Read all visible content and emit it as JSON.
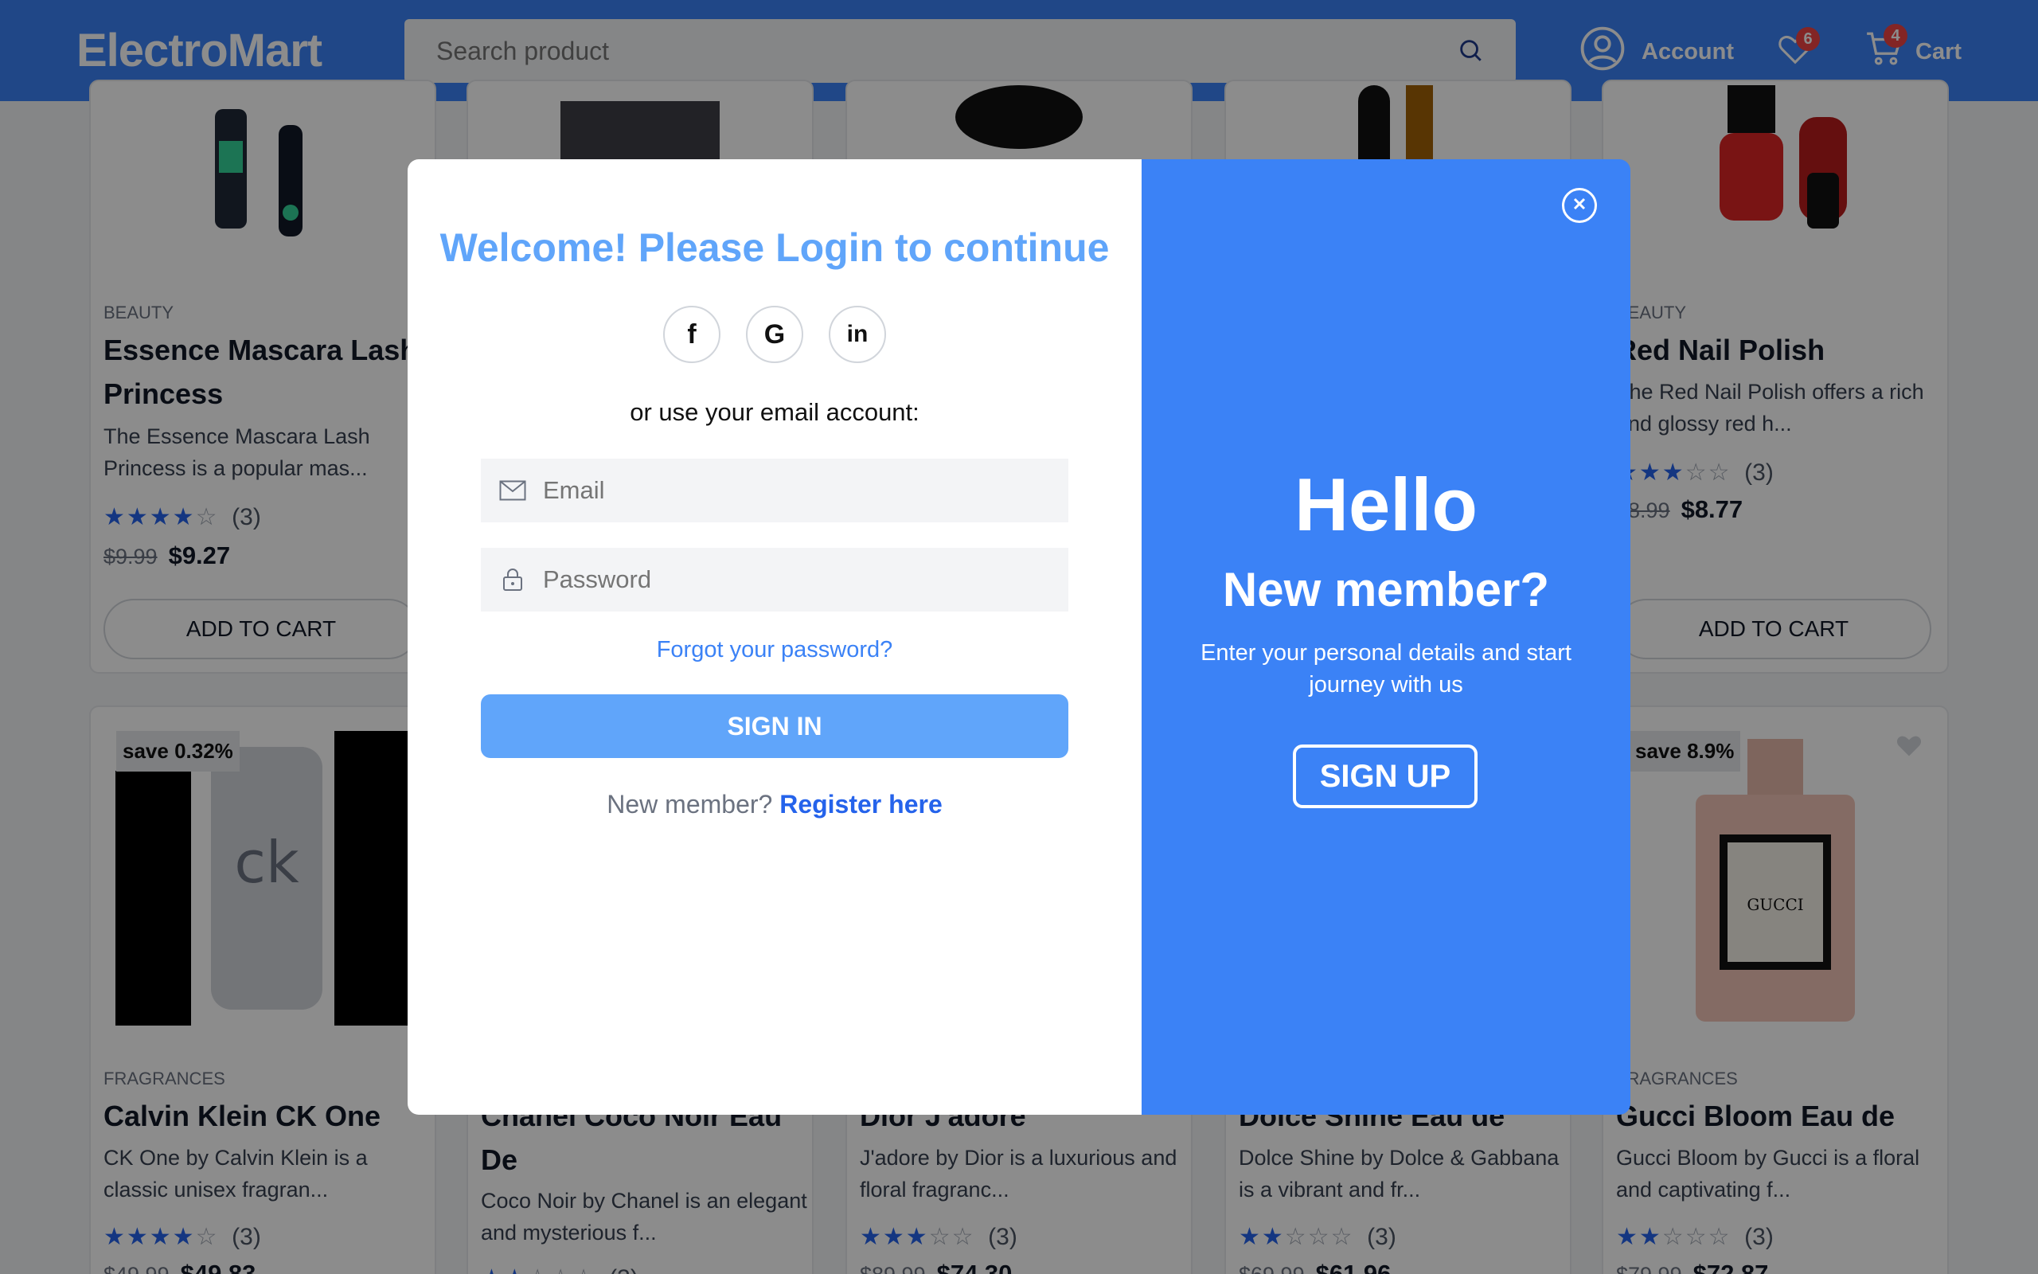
{
  "header": {
    "logo": "ElectroMart",
    "search_placeholder": "Search product",
    "account_label": "Account",
    "wishlist_count": "6",
    "cart_count": "4",
    "cart_label": "Cart"
  },
  "products_row1": [
    {
      "category": "BEAUTY",
      "name": "Essence Mascara Lash Princess",
      "description": "The Essence Mascara Lash Princess is a popular mas...",
      "rating_count": "(3)",
      "stars": 4,
      "old_price": "$9.99",
      "price": "$9.27",
      "button": "ADD TO CART"
    },
    {
      "category": "BEAUTY",
      "name": "Red Nail Polish",
      "description": "The Red Nail Polish offers a rich and glossy red h...",
      "rating_count": "(3)",
      "stars": 3,
      "old_price": "$8.99",
      "price": "$8.77",
      "button": "ADD TO CART"
    }
  ],
  "products_row2": [
    {
      "save": "save 0.32%",
      "category": "FRAGRANCES",
      "name": "Calvin Klein CK One",
      "description": "CK One by Calvin Klein is a classic unisex fragran...",
      "rating_count": "(3)",
      "stars": 4,
      "old_price": "$49.99",
      "price": "$49.83"
    },
    {
      "category": "",
      "name": "Chanel Coco Noir Eau De",
      "description": "Coco Noir by Chanel is an elegant and mysterious f...",
      "rating_count": "(3)"
    },
    {
      "category": "",
      "name": "Dior J'adore",
      "description": "J'adore by Dior is a luxurious and floral fragranc...",
      "rating_count": "(3)",
      "stars": 3,
      "old_price": "$89.99",
      "price": "$74.30"
    },
    {
      "category": "",
      "name": "Dolce Shine Eau de",
      "description": "Dolce Shine by Dolce & Gabbana is a vibrant and fr...",
      "rating_count": "(3)",
      "stars": 2,
      "old_price": "$69.99",
      "price": "$61.96"
    },
    {
      "save": "save 8.9%",
      "category": "FRAGRANCES",
      "name": "Gucci Bloom Eau de",
      "description": "Gucci Bloom by Gucci is a floral and captivating f...",
      "rating_count": "(3)",
      "stars": 2,
      "old_price": "$79.99",
      "price": "$72.87"
    }
  ],
  "login": {
    "title": "Welcome! Please Login to continue",
    "social_facebook": "f",
    "social_google": "G",
    "social_linkedin": "in",
    "or_text": "or use your email account:",
    "email_placeholder": "Email",
    "password_placeholder": "Password",
    "forgot": "Forgot your password?",
    "signin": "SIGN IN",
    "new_member_prefix": "New member?",
    "register_link": "Register here"
  },
  "promo": {
    "hello": "Hello",
    "new_member": "New member?",
    "text": "Enter your personal details and start journey with us",
    "signup": "SIGN UP"
  },
  "colors": {
    "brand": "#3b82f6",
    "title": "#60a5fa",
    "link": "#2563eb",
    "badge": "#ef4444"
  }
}
